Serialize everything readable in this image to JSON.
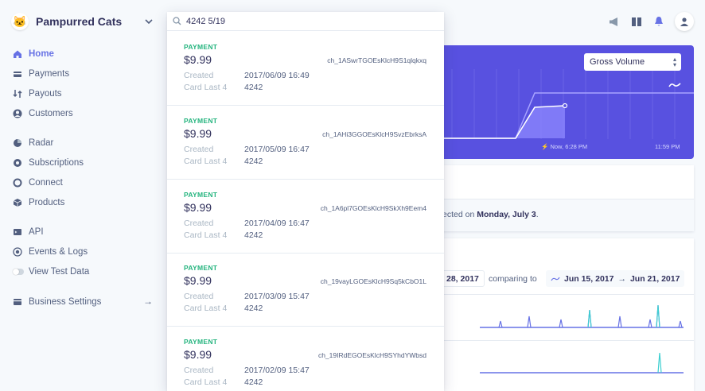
{
  "brand": {
    "name": "Pampurred Cats",
    "logo": "🐱"
  },
  "nav": {
    "main": [
      {
        "label": "Home",
        "icon": "home-icon",
        "active": true
      },
      {
        "label": "Payments",
        "icon": "payments-icon"
      },
      {
        "label": "Payouts",
        "icon": "payouts-icon"
      },
      {
        "label": "Customers",
        "icon": "customers-icon"
      }
    ],
    "products": [
      {
        "label": "Radar",
        "icon": "radar-icon"
      },
      {
        "label": "Subscriptions",
        "icon": "subscriptions-icon"
      },
      {
        "label": "Connect",
        "icon": "connect-icon"
      },
      {
        "label": "Products",
        "icon": "products-icon"
      }
    ],
    "dev": [
      {
        "label": "API",
        "icon": "api-icon"
      },
      {
        "label": "Events & Logs",
        "icon": "events-icon"
      },
      {
        "label": "View Test Data",
        "icon": "toggle"
      }
    ],
    "settings": {
      "label": "Business Settings",
      "arrow": "→"
    }
  },
  "search": {
    "query": "4242 5/19",
    "results": [
      {
        "type": "PAYMENT",
        "amount": "$9.99",
        "charge_id": "ch_1ASwrTGOEsKlcH9S1qlqkxq",
        "created_label": "Created",
        "created": "2017/06/09 16:49",
        "card_label": "Card Last 4",
        "card": "4242"
      },
      {
        "type": "PAYMENT",
        "amount": "$9.99",
        "charge_id": "ch_1AHi3GGOEsKlcH9SvzEbrksA",
        "created_label": "Created",
        "created": "2017/05/09 16:47",
        "card_label": "Card Last 4",
        "card": "4242"
      },
      {
        "type": "PAYMENT",
        "amount": "$9.99",
        "charge_id": "ch_1A6pl7GOEsKlcH9SkXh9Eem4",
        "created_label": "Created",
        "created": "2017/04/09 16:47",
        "card_label": "Card Last 4",
        "card": "4242"
      },
      {
        "type": "PAYMENT",
        "amount": "$9.99",
        "charge_id": "ch_19vayLGOEsKlcH9Sq5kCbO1L",
        "created_label": "Created",
        "created": "2017/03/09 15:47",
        "card_label": "Card Last 4",
        "card": "4242"
      },
      {
        "type": "PAYMENT",
        "amount": "$9.99",
        "charge_id": "ch_19IRdEGOEsKlcH9SYhdYWbsd",
        "created_label": "Created",
        "created": "2017/02/09 15:47",
        "card_label": "Card Last 4",
        "card": "4242"
      }
    ]
  },
  "hero": {
    "metric": "Gross Volume",
    "now_label": "Now, 6:28 PM",
    "end_label": "11:59 PM"
  },
  "notice": {
    "text": "ected on ",
    "date": "Monday, July 3",
    "end": "."
  },
  "compare": {
    "date_end": "28, 2017",
    "comparing_to": "comparing to",
    "range_start": "Jun 15, 2017",
    "range_end": "Jun 21, 2017"
  },
  "colors": {
    "accent": "#6772e5",
    "hero": "#5851e0",
    "payment": "#24b47e"
  }
}
